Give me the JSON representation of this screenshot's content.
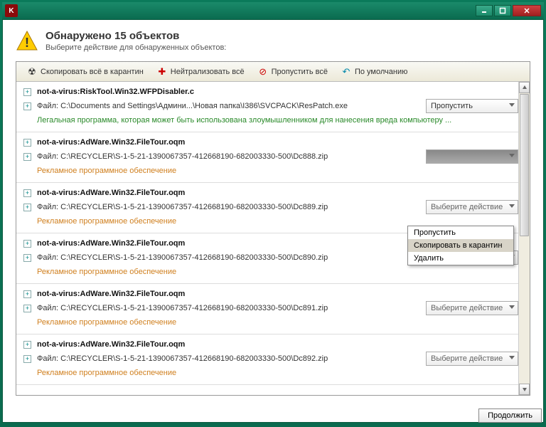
{
  "header": {
    "title": "Обнаружено 15 объектов",
    "subtitle": "Выберите действие для обнаруженных объектов:"
  },
  "toolbar": {
    "quarantine_all": "Скопировать всё в карантин",
    "neutralize_all": "Нейтрализовать всё",
    "skip_all": "Пропустить всё",
    "default": "По умолчанию"
  },
  "action_labels": {
    "skip": "Пропустить",
    "select": "Выберите действие"
  },
  "dropdown": {
    "opt1": "Пропустить",
    "opt2": "Скопировать в карантин",
    "opt3": "Удалить"
  },
  "descriptions": {
    "legal_risk": "Легальная программа, которая может быть использована злоумышленником для нанесения вреда компьютеру ...",
    "adware": "Рекламное программное обеспечение"
  },
  "items": [
    {
      "name": "not-a-virus:RiskTool.Win32.WFPDisabler.c",
      "path": "Файл: C:\\Documents and Settings\\Админи...\\Новая папка\\I386\\SVCPACK\\ResPatch.exe",
      "action": "skip",
      "desc": "legal_risk",
      "desc_class": "green"
    },
    {
      "name": "not-a-virus:AdWare.Win32.FileTour.oqm",
      "path": "Файл: C:\\RECYCLER\\S-1-5-21-1390067357-412668190-682003330-500\\Dc888.zip",
      "action": "open",
      "desc": "adware",
      "desc_class": "orange"
    },
    {
      "name": "not-a-virus:AdWare.Win32.FileTour.oqm",
      "path": "Файл: C:\\RECYCLER\\S-1-5-21-1390067357-412668190-682003330-500\\Dc889.zip",
      "action": "select",
      "desc": "adware",
      "desc_class": "orange"
    },
    {
      "name": "not-a-virus:AdWare.Win32.FileTour.oqm",
      "path": "Файл: C:\\RECYCLER\\S-1-5-21-1390067357-412668190-682003330-500\\Dc890.zip",
      "action": "select",
      "desc": "adware",
      "desc_class": "orange"
    },
    {
      "name": "not-a-virus:AdWare.Win32.FileTour.oqm",
      "path": "Файл: C:\\RECYCLER\\S-1-5-21-1390067357-412668190-682003330-500\\Dc891.zip",
      "action": "select",
      "desc": "adware",
      "desc_class": "orange"
    },
    {
      "name": "not-a-virus:AdWare.Win32.FileTour.oqm",
      "path": "Файл: C:\\RECYCLER\\S-1-5-21-1390067357-412668190-682003330-500\\Dc892.zip",
      "action": "select",
      "desc": "adware",
      "desc_class": "orange"
    }
  ],
  "footer": {
    "continue": "Продолжить"
  }
}
